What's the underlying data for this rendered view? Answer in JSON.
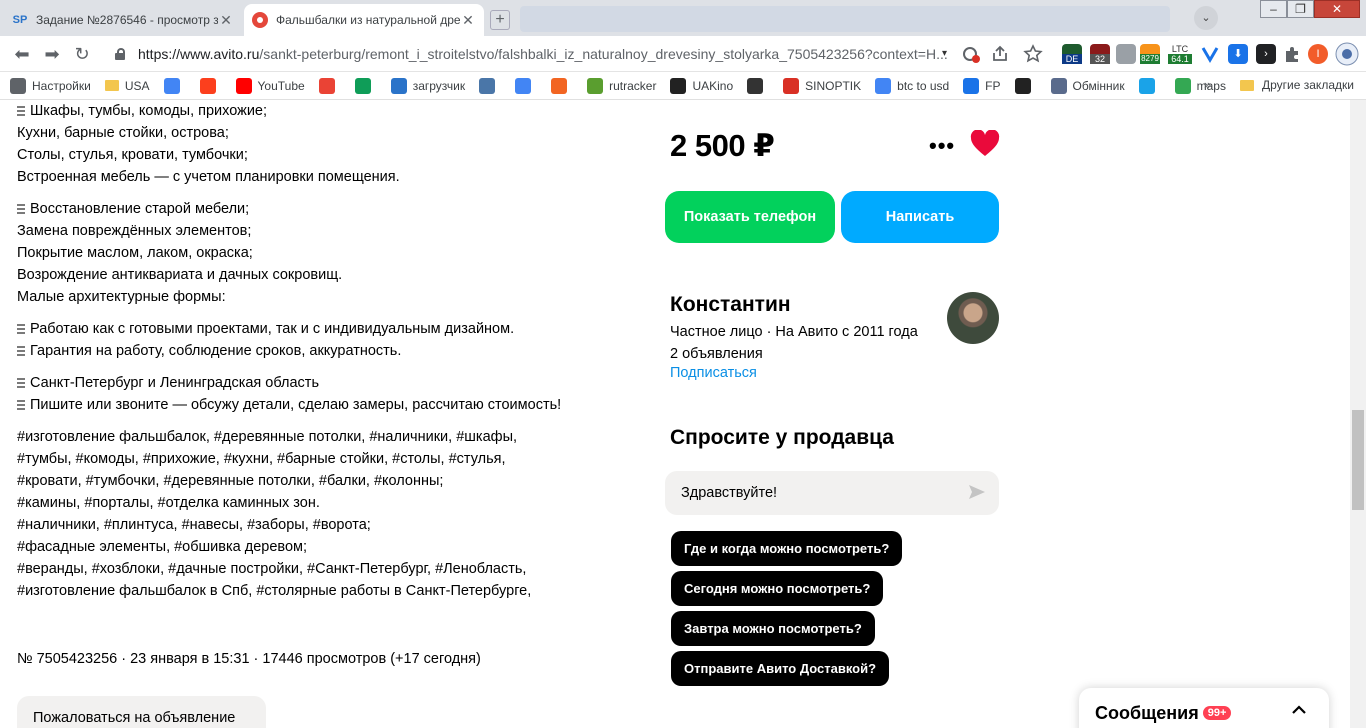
{
  "tabs": [
    {
      "favicon": "SP",
      "title": "Задание №2876546 - просмотр з",
      "active": false
    },
    {
      "favicon": "avito-icon",
      "title": "Фальшбалки из натуральной дре",
      "active": true
    }
  ],
  "tab_close_glyph": "✕",
  "new_tab_glyph": "+",
  "tab_dropdown_glyph": "⌄",
  "window_controls": {
    "minimize": "–",
    "maximize": "❐",
    "close": "✕"
  },
  "toolbar": {
    "back_glyph": "⬅",
    "forward_glyph": "➡",
    "reload_glyph": "↻",
    "url_host": "https://www.avito.ru",
    "url_path": "/sankt-peterburg/remont_i_stroitelstvo/falshbalki_iz_naturalnoy_drevesiny_stolyarka_7505423256?context=H...",
    "caret": "▾",
    "extensions": [
      "no-cookie-icon",
      "share-icon",
      "star-icon",
      "globe-de-icon",
      "badge-32-icon",
      "extension-icon",
      "bitcoin-icon",
      "ltc-icon",
      "v-icon",
      "download-icon",
      "terminal-icon",
      "puzzle-icon",
      "profile-icon",
      "menu-icon"
    ],
    "ext_labels": {
      "de": "DE",
      "n32": "32",
      "btc": "8279",
      "ltc": "LTC",
      "ltc_val": "64.1",
      "profile": "I"
    }
  },
  "bookmarks": [
    {
      "icon": "gear-icon",
      "label": "Настройки",
      "color": "#5f6368"
    },
    {
      "icon": "folder-icon",
      "label": "USA",
      "color": "#f3c64e"
    },
    {
      "icon": "google-icon",
      "label": "",
      "color": "#4285f4"
    },
    {
      "icon": "yandex-icon",
      "label": "",
      "color": "#fc3f1d"
    },
    {
      "icon": "youtube-icon",
      "label": "YouTube",
      "color": "#ff0000"
    },
    {
      "icon": "gmail-icon",
      "label": "",
      "color": "#ea4335"
    },
    {
      "icon": "drive-icon",
      "label": "",
      "color": "#0f9d58"
    },
    {
      "icon": "link-icon",
      "label": "загрузчик",
      "color": "#2a73c9"
    },
    {
      "icon": "vk-icon",
      "label": "",
      "color": "#4a76a8"
    },
    {
      "icon": "translate-icon",
      "label": "",
      "color": "#4285f4"
    },
    {
      "icon": "f-icon",
      "label": "",
      "color": "#f26522"
    },
    {
      "icon": "rutracker-icon",
      "label": "rutracker",
      "color": "#5a9e2f"
    },
    {
      "icon": "uakino-icon",
      "label": "UAKino",
      "color": "#222222"
    },
    {
      "icon": "chess-icon",
      "label": "",
      "color": "#333333"
    },
    {
      "icon": "sinoptik-icon",
      "label": "SINOPTIK",
      "color": "#d93025"
    },
    {
      "icon": "google-icon",
      "label": "btc to usd",
      "color": "#4285f4"
    },
    {
      "icon": "fp-icon",
      "label": "FP",
      "color": "#1a73e8"
    },
    {
      "icon": "bc-icon",
      "label": "",
      "color": "#222222"
    },
    {
      "icon": "exchanger-icon",
      "label": "Обмінник",
      "color": "#5a6b8c"
    },
    {
      "icon": "star-blue-icon",
      "label": "",
      "color": "#1aa3e8"
    },
    {
      "icon": "maps-icon",
      "label": "maps",
      "color": "#34a853"
    }
  ],
  "bookmarks_more": "»",
  "bookmarks_other": "Другие закладки",
  "description": {
    "block1": [
      "Шкафы, тумбы, комоды, прихожие;",
      "Кухни, барные стойки, острова;",
      "Столы, стулья, кровати, тумбочки;",
      "Встроенная мебель — с учетом планировки помещения."
    ],
    "block2": [
      "Восстановление старой мебели;",
      "Замена повреждённых элементов;",
      "Покрытие маслом, лаком, окраска;",
      "Возрождение антиквариата и дачных сокровищ.",
      "Малые архитектурные формы:"
    ],
    "block3": [
      "Работаю как с готовыми проектами, так и с индивидуальным дизайном.",
      "Гарантия на работу, соблюдение сроков, аккуратность."
    ],
    "block4": [
      "Санкт-Петербург и Ленинградская область",
      "Пишите или звоните — обсужу детали, сделаю замеры, рассчитаю стоимость!"
    ],
    "hashtags": [
      "#изготовление фальшбалок, #деревянные потолки, #наличники, #шкафы,",
      "#тумбы, #комоды, #прихожие, #кухни, #барные стойки, #столы, #стулья,",
      "#кровати, #тумбочки, #деревянные потолки, #балки, #колонны;",
      "#камины, #порталы, #отделка каминных зон.",
      "#наличники, #плинтуса, #навесы, #заборы, #ворота;",
      "#фасадные элементы, #обшивка деревом;",
      "#веранды, #хозблоки, #дачные постройки, #Санкт-Петербург, #Ленобласть,",
      "#изготовление фальшбалок в Спб, #столярные работы в Санкт-Петербурге,"
    ]
  },
  "meta": "№ 7505423256 · 23 января в 15:31 · 17446 просмотров (+17 сегодня)",
  "complain_label": "Пожаловаться на объявление",
  "price": "2 500 ₽",
  "more_dots": "•••",
  "buttons": {
    "phone": "Показать телефон",
    "write": "Написать"
  },
  "seller": {
    "name": "Константин",
    "info": "Частное лицо · На Авито с 2011 года",
    "ads": "2 объявления",
    "subscribe": "Подписаться"
  },
  "ask": {
    "title": "Спросите у продавца",
    "input_value": "Здравствуйте!",
    "quick_questions": [
      "Где и когда можно посмотреть?",
      "Сегодня можно посмотреть?",
      "Завтра можно посмотреть?",
      "Отправите Авито Доставкой?"
    ]
  },
  "messages": {
    "label": "Сообщения",
    "badge": "99+"
  },
  "colors": {
    "green": "#02d15c",
    "blue": "#00aaff",
    "heart": "#ea0a3b",
    "link": "#0a8fe5"
  }
}
